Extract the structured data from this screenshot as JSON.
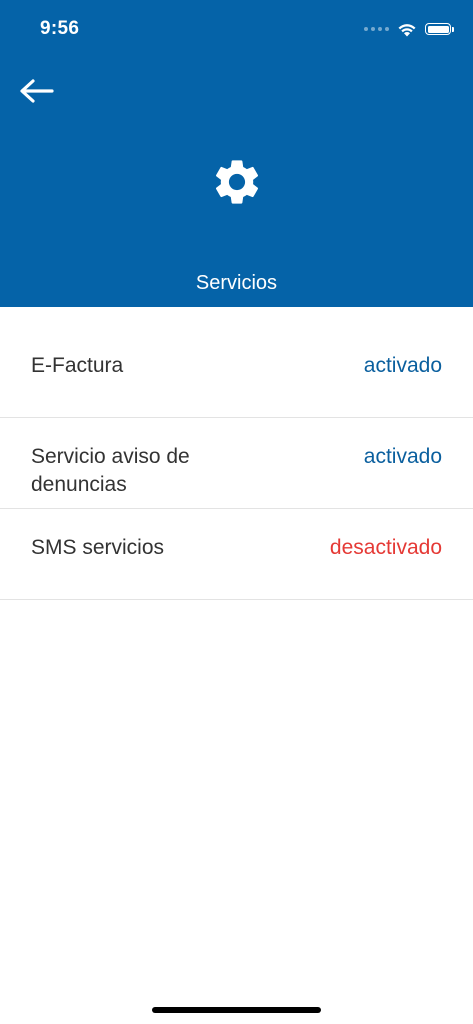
{
  "status_bar": {
    "time": "9:56"
  },
  "header": {
    "back_icon": "arrow-left-icon",
    "settings_icon": "gear-icon",
    "title": "Servicios",
    "background_color": "#0563a8"
  },
  "services": [
    {
      "label": "E-Factura",
      "status": "activado",
      "status_color": "#0a5f9e"
    },
    {
      "label": "Servicio aviso de denuncias",
      "status": "activado",
      "status_color": "#0a5f9e"
    },
    {
      "label": "SMS servicios",
      "status": "desactivado",
      "status_color": "#e53935"
    }
  ]
}
